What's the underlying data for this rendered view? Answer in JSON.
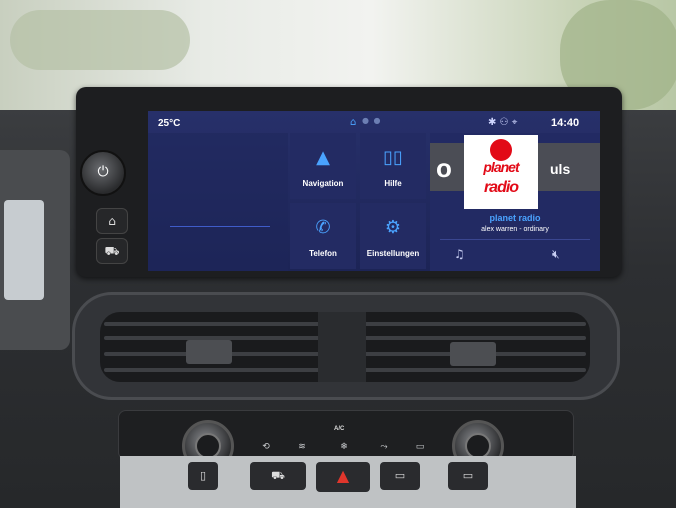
{
  "status_bar": {
    "temperature": "25°C",
    "home_icon": "home-icon",
    "status_icons": "✱ ⚇ ⌖",
    "clock": "14:40"
  },
  "tiles": {
    "navigation": {
      "label": "Navigation",
      "icon": "navigation-arrow-icon"
    },
    "help": {
      "label": "Hilfe",
      "icon": "book-icon"
    },
    "phone": {
      "label": "Telefon",
      "icon": "phone-icon"
    },
    "settings": {
      "label": "Einstellungen",
      "icon": "gear-icon"
    }
  },
  "radio": {
    "logo_line1": "planet",
    "logo_line2": "radio",
    "station": "planet radio",
    "track": "alex warren - ordinary",
    "bg_left": "o",
    "bg_right": "uls"
  },
  "controls": {
    "ac_label": "A/C"
  }
}
